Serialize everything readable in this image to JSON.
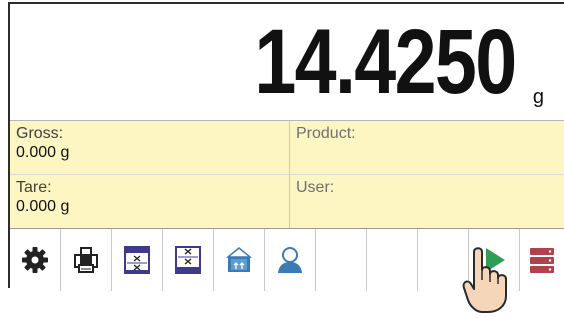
{
  "readout": {
    "value": "14.4250",
    "unit": "g"
  },
  "info": {
    "gross_label": "Gross:",
    "gross_value": "0.000 g",
    "tare_label": "Tare:",
    "tare_value": "0.000 g",
    "product_label": "Product:",
    "user_label": "User:"
  },
  "toolbar": {
    "buttons": [
      {
        "icon": "gear-icon"
      },
      {
        "icon": "printer-icon"
      },
      {
        "icon": "database-icon"
      },
      {
        "icon": "database-icon"
      },
      {
        "icon": "weighing-box-icon"
      },
      {
        "icon": "user-icon"
      },
      {
        "icon": "empty"
      },
      {
        "icon": "empty"
      },
      {
        "icon": "play-icon"
      },
      {
        "icon": "storage-icon"
      }
    ]
  },
  "colors": {
    "info_background": "#fdf5c2",
    "icon_blue": "#3d3a8c",
    "play_green": "#2e9e57",
    "storage_red": "#b1414b"
  }
}
